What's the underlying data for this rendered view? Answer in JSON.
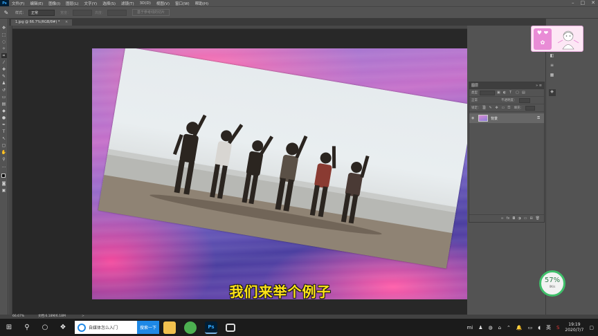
{
  "menubar": {
    "logo": "Ps",
    "items": [
      "文件(F)",
      "编辑(E)",
      "图像(I)",
      "图层(L)",
      "文字(Y)",
      "选择(S)",
      "滤镜(T)",
      "3D(D)",
      "视图(V)",
      "窗口(W)",
      "帮助(H)"
    ],
    "window_controls": [
      "–",
      "□",
      "✕"
    ]
  },
  "options": {
    "style_label": "样式：",
    "style_value": "正常",
    "width_label": "宽度：",
    "height_label": "高度：",
    "refine_button": "基于参考线的切片"
  },
  "document": {
    "tab_title": "1.jpg @ 66.7%(RGB/8#) *",
    "tab_close": "×"
  },
  "caption": "我们来举个例子",
  "layers_panel": {
    "title": "图层",
    "kind_label": "类型",
    "mode_value": "正常",
    "opacity_label": "不透明度：",
    "lock_label": "锁定：",
    "fill_label": "填充：",
    "layer_name": "背景",
    "footer_icons": [
      "link-icon",
      "fx-icon",
      "mask-icon",
      "adjustment-icon",
      "group-icon",
      "new-layer-icon",
      "delete-icon"
    ]
  },
  "sticker": {
    "hearts": "♥ ❤",
    "flower": "✿"
  },
  "status": {
    "zoom": "66.67%",
    "doc_size": "文档:6.18M/6.18M",
    "arrow": ">"
  },
  "progress_badge": {
    "percent": "57%",
    "speed": "0K/s",
    "ring_color": "#3fbf6a"
  },
  "taskbar": {
    "search_text": "自媒体怎么入门",
    "search_button": "搜索一下",
    "ps_label": "Ps",
    "ime": "英",
    "time": "19:19",
    "date": "2020/7/7"
  },
  "colors": {
    "caption": "#ffe417",
    "accent": "#31a8ff"
  }
}
